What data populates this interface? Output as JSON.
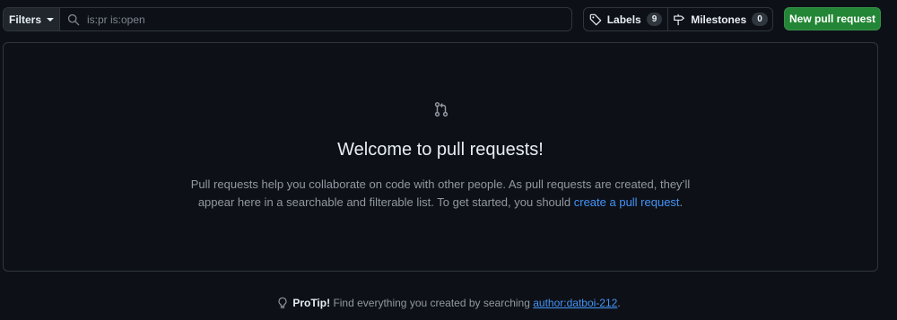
{
  "toolbar": {
    "filters_label": "Filters",
    "search": {
      "value": "",
      "placeholder": "is:pr is:open"
    },
    "labels": {
      "label": "Labels",
      "count": "9"
    },
    "milestones": {
      "label": "Milestones",
      "count": "0"
    },
    "new_pr_label": "New pull request"
  },
  "blankslate": {
    "icon": "git-pull-request-icon",
    "title": "Welcome to pull requests!",
    "description_pre": "Pull requests help you collaborate on code with other people. As pull requests are created, they’ll appear here in a searchable and filterable list. To get started, you should ",
    "link_text": "create a pull request",
    "description_post": "."
  },
  "protip": {
    "icon": "light-bulb-icon",
    "label": "ProTip!",
    "text": "Find everything you created by searching",
    "link_text": "author:datboi-212",
    "suffix": "."
  },
  "colors": {
    "background": "#0d1117",
    "border": "#30363d",
    "primary_button": "#238636",
    "link": "#4493f8",
    "muted_text": "#9198a1"
  }
}
